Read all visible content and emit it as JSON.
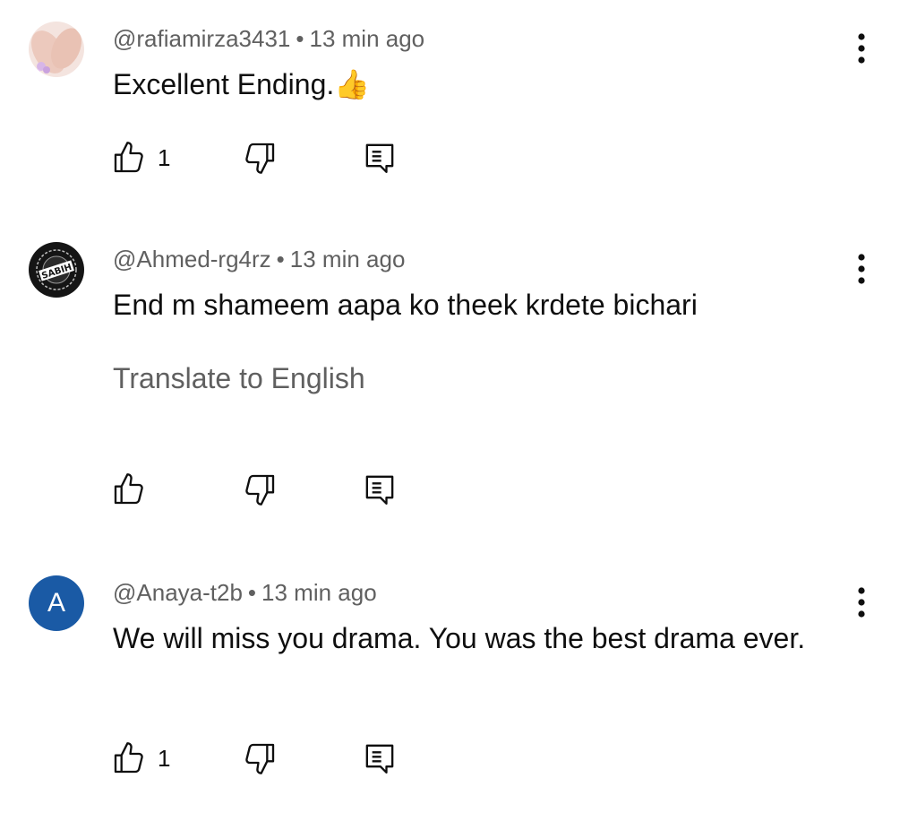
{
  "comments": [
    {
      "author": "@rafiamirza3431",
      "time": "13 min ago",
      "text": "Excellent Ending.",
      "emoji": "👍",
      "likes": "1",
      "avatar": "photo-feet"
    },
    {
      "author": "@Ahmed-rg4rz",
      "time": "13 min ago",
      "text": "End m shameem aapa ko theek krdete bichari",
      "translate": "Translate to English",
      "avatar": "sabih-logo",
      "avatar_text": "SABIH"
    },
    {
      "author": "@Anaya-t2b",
      "time": "13 min ago",
      "text": "We will miss you drama. You was the best drama ever.",
      "likes": "1",
      "avatar_letter": "A",
      "avatar_color": "#1a5aa5"
    }
  ],
  "separator": "•",
  "icons": {
    "like": "thumbs-up-icon",
    "dislike": "thumbs-down-icon",
    "reply": "reply-comment-icon",
    "menu": "more-vert-icon"
  }
}
